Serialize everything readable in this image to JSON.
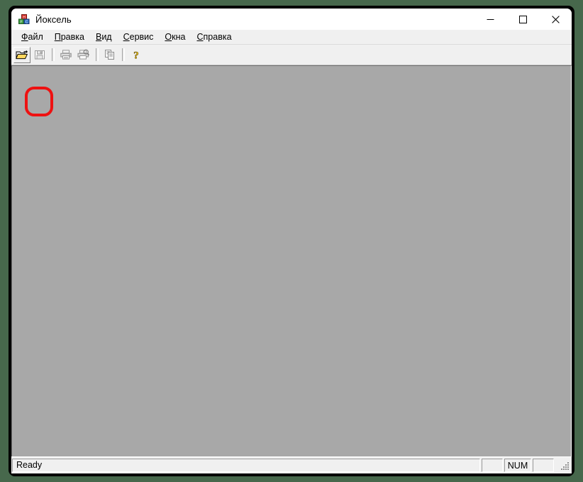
{
  "window": {
    "title": "Йоксель",
    "icon": "toy-blocks-icon",
    "caption_buttons": [
      {
        "name": "minimize",
        "label": "—"
      },
      {
        "name": "maximize",
        "label": "☐"
      },
      {
        "name": "close",
        "label": "✕"
      }
    ]
  },
  "menubar": {
    "items": [
      {
        "name": "file",
        "accel": "Ф",
        "rest": "айл"
      },
      {
        "name": "edit",
        "accel": "П",
        "rest": "равка"
      },
      {
        "name": "view",
        "accel": "В",
        "rest": "ид"
      },
      {
        "name": "service",
        "accel": "С",
        "rest": "ервис"
      },
      {
        "name": "windows",
        "accel": "О",
        "rest": "кна"
      },
      {
        "name": "help",
        "accel": "С",
        "rest": "правка"
      }
    ]
  },
  "toolbar": {
    "buttons": [
      {
        "name": "open-file",
        "icon": "open-folder-icon",
        "enabled": true,
        "highlighted": true
      },
      {
        "name": "save-file",
        "icon": "floppy-disk-icon",
        "enabled": false,
        "highlighted": false
      },
      {
        "name": "print",
        "icon": "printer-icon",
        "enabled": false,
        "highlighted": false
      },
      {
        "name": "print-preview",
        "icon": "print-preview-icon",
        "enabled": false,
        "highlighted": false
      },
      {
        "name": "copy",
        "icon": "copy-icon",
        "enabled": false,
        "highlighted": false
      },
      {
        "name": "help",
        "icon": "question-mark-icon",
        "enabled": true,
        "highlighted": false
      }
    ]
  },
  "statusbar": {
    "message": "Ready",
    "panes": [
      "",
      "NUM",
      ""
    ]
  },
  "colors": {
    "desktop_background": "#47684c",
    "window_chrome": "#f0f0f0",
    "mdi_client": "#a8a8a8",
    "annotation": "#ee1111",
    "icon_folder": "#ffd75e",
    "icon_help": "#e8c020"
  }
}
